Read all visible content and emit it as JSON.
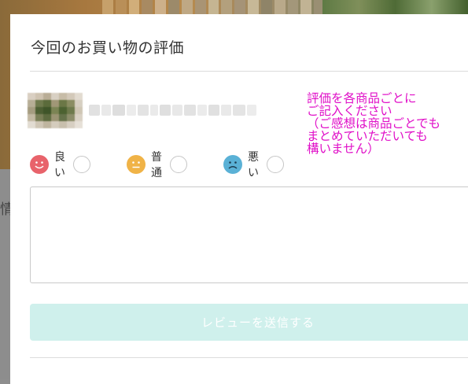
{
  "modal": {
    "title": "今回のお買い物の評価",
    "note_text": "評価を各商品ごとに\nご記入ください\n（ご感想は商品ごとでも\nまとめていただいても\n構いません）",
    "note_color": "#e010c8",
    "ratings": [
      {
        "label": "良い",
        "color": "#e8636b",
        "icon": "smile-face-icon"
      },
      {
        "label": "普通",
        "color": "#f0b347",
        "icon": "neutral-face-icon"
      },
      {
        "label": "悪い",
        "color": "#5ab1d6",
        "icon": "sad-face-icon"
      }
    ],
    "review_placeholder": "",
    "submit_label": "レビューを送信する",
    "submit_color": "#cff0ec"
  },
  "background": {
    "partial_char": "情"
  }
}
